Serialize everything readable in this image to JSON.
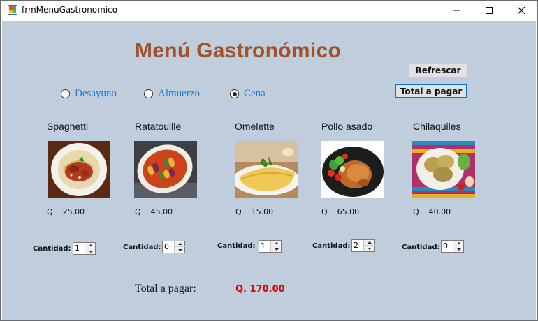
{
  "window": {
    "title": "frmMenuGastronomico"
  },
  "form": {
    "heading": "Menú Gastronómico",
    "buttons": {
      "refresh": "Refrescar",
      "total": "Total a pagar"
    },
    "meal_options": [
      {
        "label": "Desayuno",
        "checked": false
      },
      {
        "label": "Almuerzo",
        "checked": false
      },
      {
        "label": "Cena",
        "checked": true
      }
    ],
    "dishes": [
      {
        "name": "Spaghetti",
        "price": "Q    25.00",
        "qty_label": "Cantidad:",
        "qty": "1"
      },
      {
        "name": "Ratatouille",
        "price": "Q    45.00",
        "qty_label": "Cantidad:",
        "qty": "0"
      },
      {
        "name": "Omelette",
        "price": "Q    15.00",
        "qty_label": "Cantidad:",
        "qty": "1"
      },
      {
        "name": "Pollo asado",
        "price": "Q    65.00",
        "qty_label": "Cantidad:",
        "qty": "2"
      },
      {
        "name": "Chilaquiles",
        "price": "Q    40.00",
        "qty_label": "Cantidad:",
        "qty": "0"
      }
    ],
    "total_label": "Total a pagar:",
    "total_value": "Q. 170.00"
  },
  "colors": {
    "client_bg": "#bfcddc",
    "heading": "#a0522d",
    "radio_text": "#1e7ad6",
    "total_value": "#e00000",
    "focus_border": "#0078d7"
  },
  "icons": [
    "app-icon",
    "minimize-icon",
    "maximize-icon",
    "close-icon",
    "spin-up-icon",
    "spin-down-icon"
  ]
}
